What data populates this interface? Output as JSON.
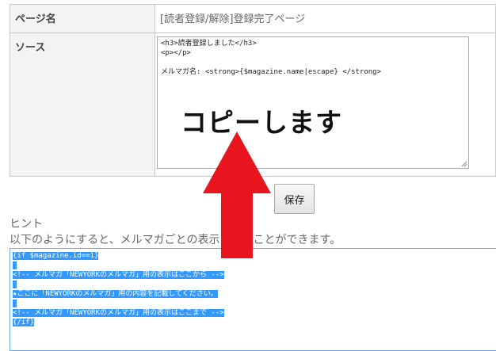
{
  "table": {
    "page_name_label": "ページ名",
    "page_name_value": "[読者登録/解除]登録完了ページ",
    "source_label": "ソース"
  },
  "source_code": {
    "lines": [
      "<h3>読者登録しました</h3>",
      "<p></p>",
      "",
      "メルマガ名: <strong>{$magazine.name|escape} </strong>"
    ]
  },
  "save_button": {
    "label": "保存"
  },
  "hint": {
    "title": "ヒント",
    "description": "以下のようにすると、メルマガごとの表示　　　ことができます。",
    "code_lines": [
      "{if $magazine.id==1}",
      "",
      "<!-- メルマガ「NEWYORKのメルマガ」用の表示はここから -->",
      "",
      "★ここに「NEWYORKのメルマガ」用の内容を記載してください。",
      "",
      "<!-- メルマガ「NEWYORKのメルマガ」用の表示はここまで -->",
      "{/if}"
    ]
  },
  "annotation": {
    "text": "コピーします",
    "arrow_color": "#e8141e"
  }
}
